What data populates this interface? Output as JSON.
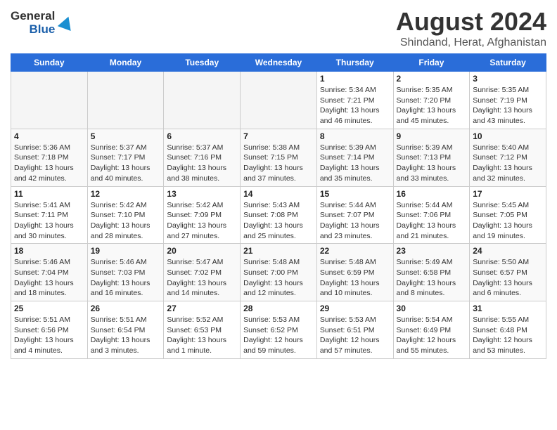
{
  "header": {
    "logo_line1": "General",
    "logo_line2": "Blue",
    "month_title": "August 2024",
    "location": "Shindand, Herat, Afghanistan"
  },
  "days_of_week": [
    "Sunday",
    "Monday",
    "Tuesday",
    "Wednesday",
    "Thursday",
    "Friday",
    "Saturday"
  ],
  "weeks": [
    [
      {
        "day": "",
        "info": ""
      },
      {
        "day": "",
        "info": ""
      },
      {
        "day": "",
        "info": ""
      },
      {
        "day": "",
        "info": ""
      },
      {
        "day": "1",
        "info": "Sunrise: 5:34 AM\nSunset: 7:21 PM\nDaylight: 13 hours\nand 46 minutes."
      },
      {
        "day": "2",
        "info": "Sunrise: 5:35 AM\nSunset: 7:20 PM\nDaylight: 13 hours\nand 45 minutes."
      },
      {
        "day": "3",
        "info": "Sunrise: 5:35 AM\nSunset: 7:19 PM\nDaylight: 13 hours\nand 43 minutes."
      }
    ],
    [
      {
        "day": "4",
        "info": "Sunrise: 5:36 AM\nSunset: 7:18 PM\nDaylight: 13 hours\nand 42 minutes."
      },
      {
        "day": "5",
        "info": "Sunrise: 5:37 AM\nSunset: 7:17 PM\nDaylight: 13 hours\nand 40 minutes."
      },
      {
        "day": "6",
        "info": "Sunrise: 5:37 AM\nSunset: 7:16 PM\nDaylight: 13 hours\nand 38 minutes."
      },
      {
        "day": "7",
        "info": "Sunrise: 5:38 AM\nSunset: 7:15 PM\nDaylight: 13 hours\nand 37 minutes."
      },
      {
        "day": "8",
        "info": "Sunrise: 5:39 AM\nSunset: 7:14 PM\nDaylight: 13 hours\nand 35 minutes."
      },
      {
        "day": "9",
        "info": "Sunrise: 5:39 AM\nSunset: 7:13 PM\nDaylight: 13 hours\nand 33 minutes."
      },
      {
        "day": "10",
        "info": "Sunrise: 5:40 AM\nSunset: 7:12 PM\nDaylight: 13 hours\nand 32 minutes."
      }
    ],
    [
      {
        "day": "11",
        "info": "Sunrise: 5:41 AM\nSunset: 7:11 PM\nDaylight: 13 hours\nand 30 minutes."
      },
      {
        "day": "12",
        "info": "Sunrise: 5:42 AM\nSunset: 7:10 PM\nDaylight: 13 hours\nand 28 minutes."
      },
      {
        "day": "13",
        "info": "Sunrise: 5:42 AM\nSunset: 7:09 PM\nDaylight: 13 hours\nand 27 minutes."
      },
      {
        "day": "14",
        "info": "Sunrise: 5:43 AM\nSunset: 7:08 PM\nDaylight: 13 hours\nand 25 minutes."
      },
      {
        "day": "15",
        "info": "Sunrise: 5:44 AM\nSunset: 7:07 PM\nDaylight: 13 hours\nand 23 minutes."
      },
      {
        "day": "16",
        "info": "Sunrise: 5:44 AM\nSunset: 7:06 PM\nDaylight: 13 hours\nand 21 minutes."
      },
      {
        "day": "17",
        "info": "Sunrise: 5:45 AM\nSunset: 7:05 PM\nDaylight: 13 hours\nand 19 minutes."
      }
    ],
    [
      {
        "day": "18",
        "info": "Sunrise: 5:46 AM\nSunset: 7:04 PM\nDaylight: 13 hours\nand 18 minutes."
      },
      {
        "day": "19",
        "info": "Sunrise: 5:46 AM\nSunset: 7:03 PM\nDaylight: 13 hours\nand 16 minutes."
      },
      {
        "day": "20",
        "info": "Sunrise: 5:47 AM\nSunset: 7:02 PM\nDaylight: 13 hours\nand 14 minutes."
      },
      {
        "day": "21",
        "info": "Sunrise: 5:48 AM\nSunset: 7:00 PM\nDaylight: 13 hours\nand 12 minutes."
      },
      {
        "day": "22",
        "info": "Sunrise: 5:48 AM\nSunset: 6:59 PM\nDaylight: 13 hours\nand 10 minutes."
      },
      {
        "day": "23",
        "info": "Sunrise: 5:49 AM\nSunset: 6:58 PM\nDaylight: 13 hours\nand 8 minutes."
      },
      {
        "day": "24",
        "info": "Sunrise: 5:50 AM\nSunset: 6:57 PM\nDaylight: 13 hours\nand 6 minutes."
      }
    ],
    [
      {
        "day": "25",
        "info": "Sunrise: 5:51 AM\nSunset: 6:56 PM\nDaylight: 13 hours\nand 4 minutes."
      },
      {
        "day": "26",
        "info": "Sunrise: 5:51 AM\nSunset: 6:54 PM\nDaylight: 13 hours\nand 3 minutes."
      },
      {
        "day": "27",
        "info": "Sunrise: 5:52 AM\nSunset: 6:53 PM\nDaylight: 13 hours\nand 1 minute."
      },
      {
        "day": "28",
        "info": "Sunrise: 5:53 AM\nSunset: 6:52 PM\nDaylight: 12 hours\nand 59 minutes."
      },
      {
        "day": "29",
        "info": "Sunrise: 5:53 AM\nSunset: 6:51 PM\nDaylight: 12 hours\nand 57 minutes."
      },
      {
        "day": "30",
        "info": "Sunrise: 5:54 AM\nSunset: 6:49 PM\nDaylight: 12 hours\nand 55 minutes."
      },
      {
        "day": "31",
        "info": "Sunrise: 5:55 AM\nSunset: 6:48 PM\nDaylight: 12 hours\nand 53 minutes."
      }
    ]
  ]
}
